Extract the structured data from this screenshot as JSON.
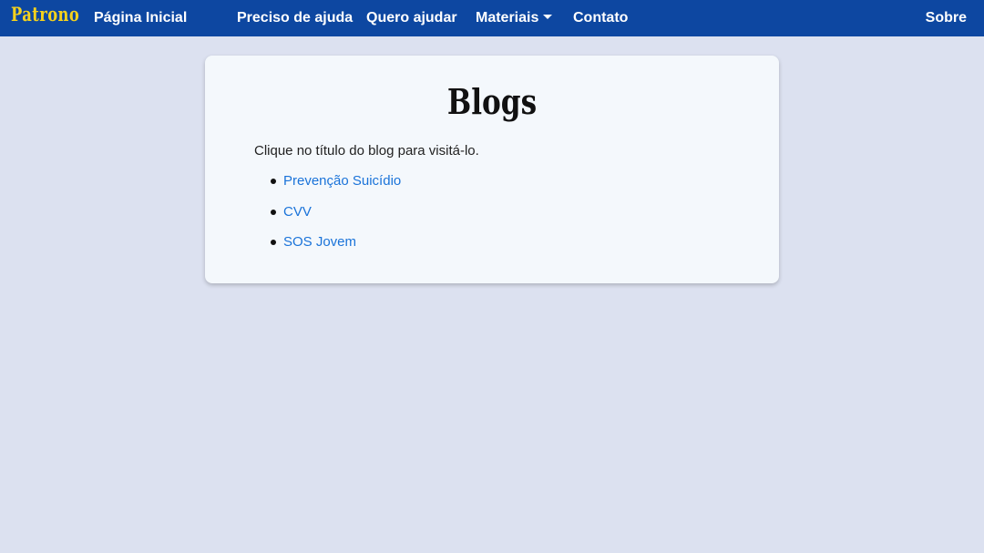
{
  "navbar": {
    "brand": "Patrono",
    "home": "Página Inicial",
    "need_help": "Preciso de ajuda",
    "want_help": "Quero ajudar",
    "materials": "Materiais",
    "contact": "Contato",
    "about": "Sobre"
  },
  "main": {
    "title": "Blogs",
    "intro": "Clique no título do blog para visitá-lo.",
    "blogs": [
      {
        "label": "Prevenção Suicídio"
      },
      {
        "label": "CVV"
      },
      {
        "label": "SOS Jovem"
      }
    ]
  },
  "colors": {
    "navbar_bg": "#0d47a1",
    "brand": "#f5d21c",
    "page_bg": "#dce1f0",
    "card_bg": "#f4f8fc",
    "link": "#1a73d9"
  }
}
